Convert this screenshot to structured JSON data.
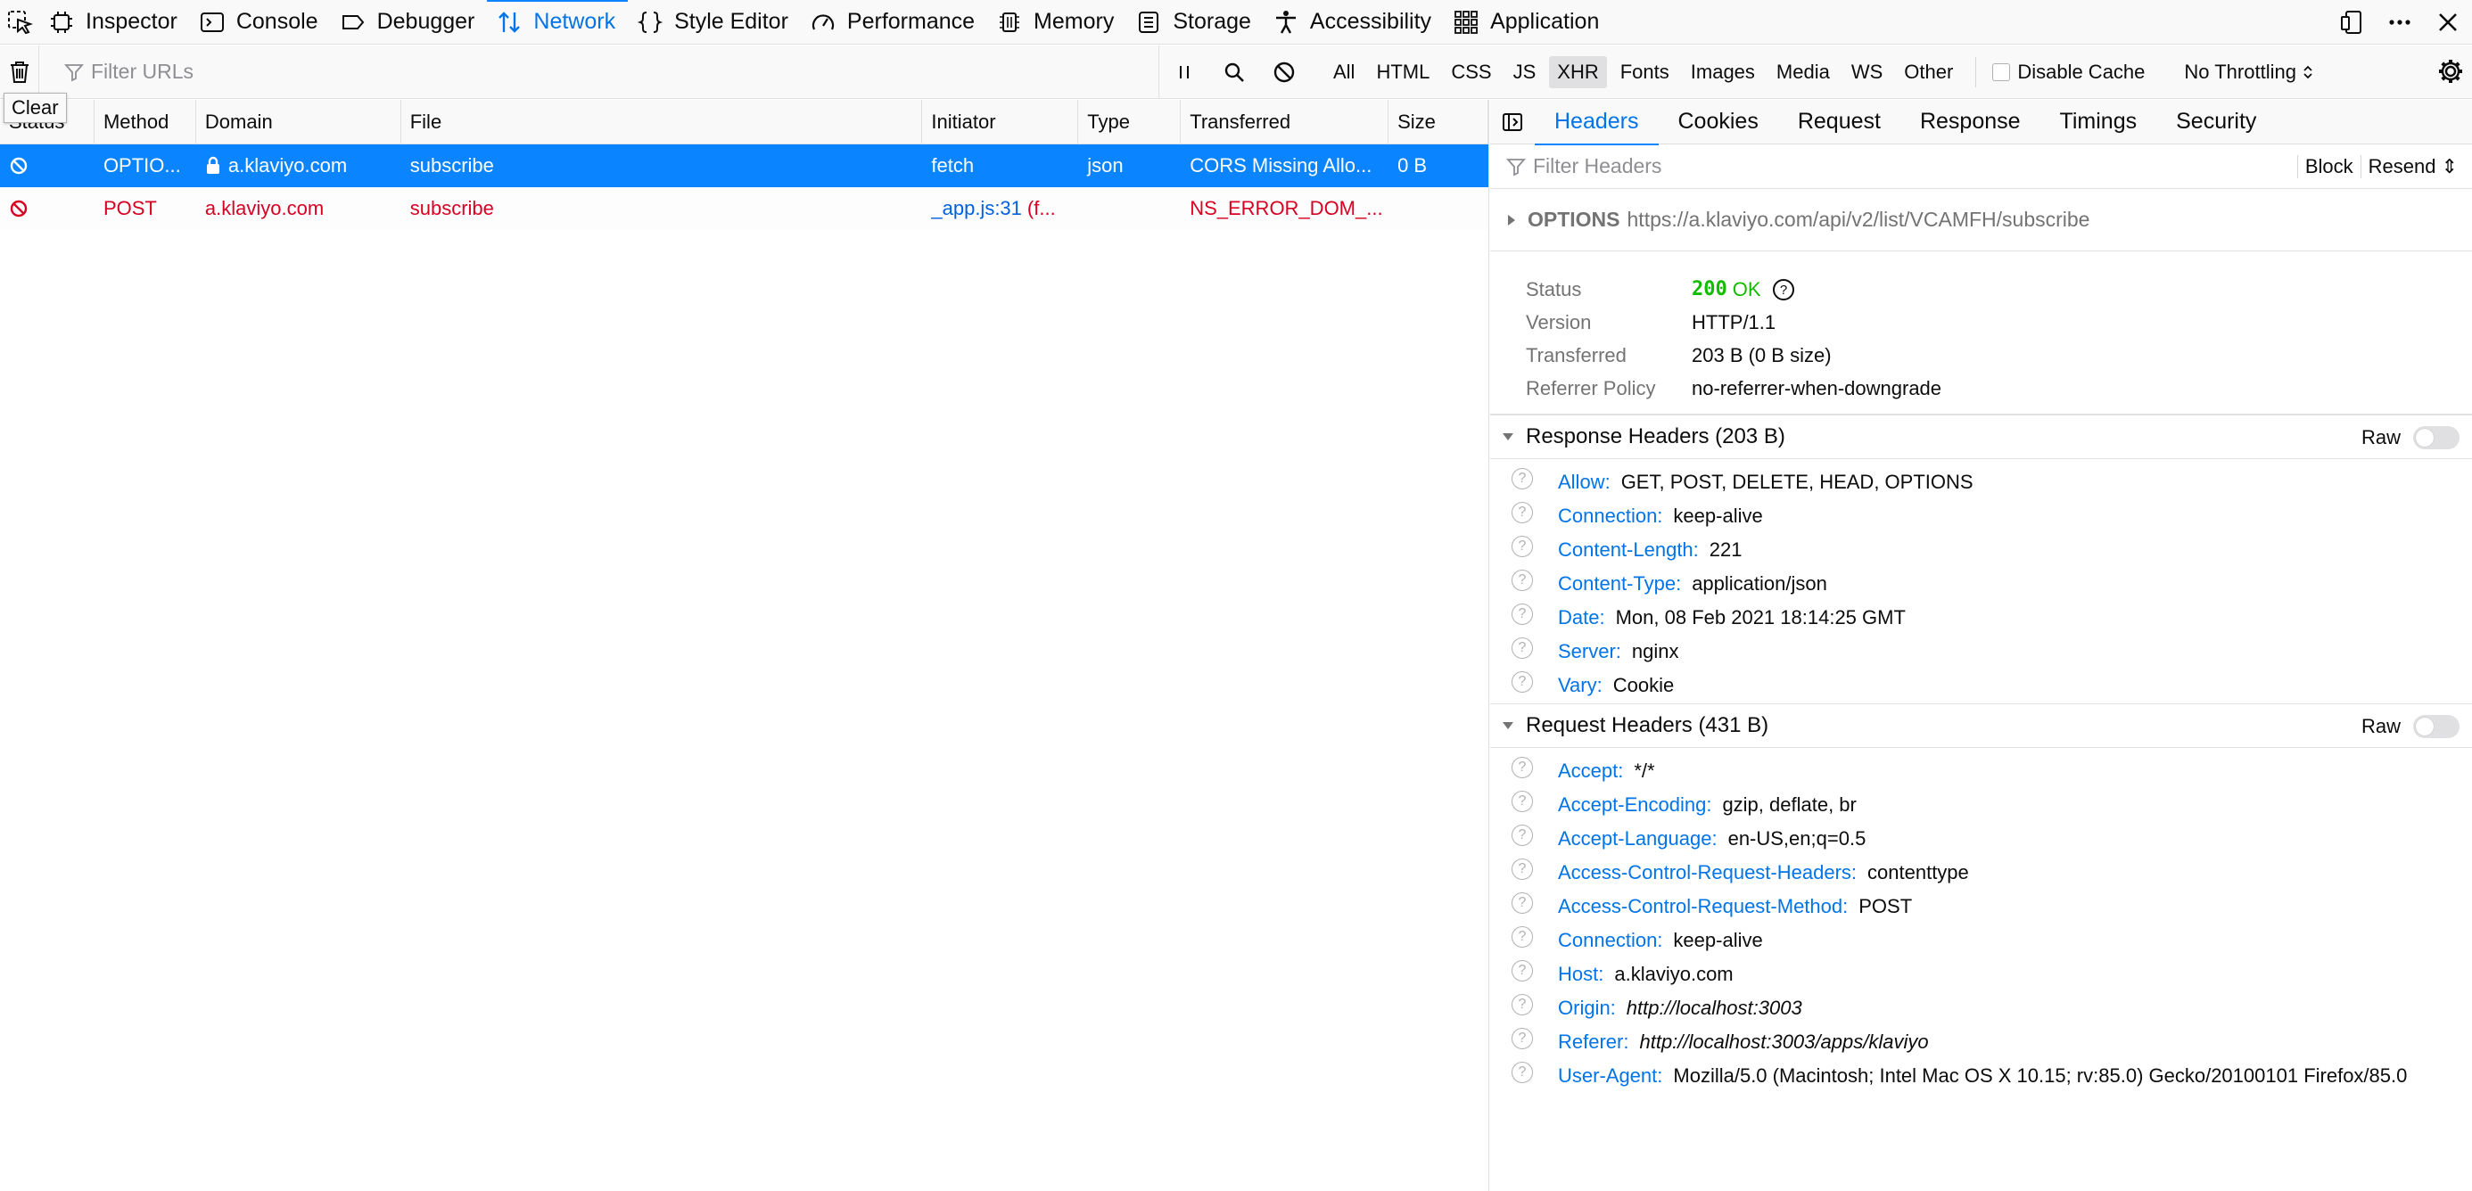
{
  "toolbar": {
    "tabs": [
      {
        "label": "Inspector",
        "icon": "inspector-icon"
      },
      {
        "label": "Console",
        "icon": "console-icon"
      },
      {
        "label": "Debugger",
        "icon": "debugger-icon"
      },
      {
        "label": "Network",
        "icon": "network-icon",
        "active": true
      },
      {
        "label": "Style Editor",
        "icon": "style-editor-icon"
      },
      {
        "label": "Performance",
        "icon": "performance-icon"
      },
      {
        "label": "Memory",
        "icon": "memory-icon"
      },
      {
        "label": "Storage",
        "icon": "storage-icon"
      },
      {
        "label": "Accessibility",
        "icon": "accessibility-icon"
      },
      {
        "label": "Application",
        "icon": "application-icon"
      }
    ]
  },
  "filterbar": {
    "filter_placeholder": "Filter URLs",
    "types": [
      "All",
      "HTML",
      "CSS",
      "JS",
      "XHR",
      "Fonts",
      "Images",
      "Media",
      "WS",
      "Other"
    ],
    "active_type": "XHR",
    "disable_cache": "Disable Cache",
    "throttling": "No Throttling"
  },
  "tooltip": "Clear",
  "list": {
    "columns": [
      "Status",
      "Method",
      "Domain",
      "File",
      "Initiator",
      "Type",
      "Transferred",
      "Size"
    ],
    "rows": [
      {
        "method": "OPTIO...",
        "domain": "a.klaviyo.com",
        "file": "subscribe",
        "initiator": "fetch",
        "type": "json",
        "transferred": "CORS Missing Allo...",
        "size": "0 B"
      },
      {
        "method": "POST",
        "domain": "a.klaviyo.com",
        "file": "subscribe",
        "initiator": "_app.js:31",
        "initiator_extra": "(f...",
        "type": "",
        "transferred": "NS_ERROR_DOM_...",
        "size": ""
      }
    ]
  },
  "side": {
    "tabs": [
      "Headers",
      "Cookies",
      "Request",
      "Response",
      "Timings",
      "Security"
    ],
    "filter_placeholder": "Filter Headers",
    "block": "Block",
    "resend": "Resend",
    "summary_method": "OPTIONS",
    "summary_url": "https://a.klaviyo.com/api/v2/list/VCAMFH/subscribe",
    "status": {
      "status_label": "Status",
      "status_code": "200",
      "status_text": "OK",
      "version_label": "Version",
      "version": "HTTP/1.1",
      "transferred_label": "Transferred",
      "transferred": "203 B (0 B size)",
      "referrer_label": "Referrer Policy",
      "referrer": "no-referrer-when-downgrade"
    },
    "response_title": "Response Headers (203 B)",
    "request_title": "Request Headers (431 B)",
    "raw": "Raw",
    "response_headers": [
      {
        "name": "Allow:",
        "value": "GET, POST, DELETE, HEAD, OPTIONS"
      },
      {
        "name": "Connection:",
        "value": "keep-alive"
      },
      {
        "name": "Content-Length:",
        "value": "221"
      },
      {
        "name": "Content-Type:",
        "value": "application/json"
      },
      {
        "name": "Date:",
        "value": "Mon, 08 Feb 2021 18:14:25 GMT"
      },
      {
        "name": "Server:",
        "value": "nginx"
      },
      {
        "name": "Vary:",
        "value": "Cookie"
      }
    ],
    "request_headers": [
      {
        "name": "Accept:",
        "value": "*/*"
      },
      {
        "name": "Accept-Encoding:",
        "value": "gzip, deflate, br"
      },
      {
        "name": "Accept-Language:",
        "value": "en-US,en;q=0.5"
      },
      {
        "name": "Access-Control-Request-Headers:",
        "value": "contenttype"
      },
      {
        "name": "Access-Control-Request-Method:",
        "value": "POST"
      },
      {
        "name": "Connection:",
        "value": "keep-alive"
      },
      {
        "name": "Host:",
        "value": "a.klaviyo.com"
      },
      {
        "name": "Origin:",
        "value": "http://localhost:3003",
        "italic": true
      },
      {
        "name": "Referer:",
        "value": "http://localhost:3003/apps/klaviyo",
        "italic": true
      },
      {
        "name": "User-Agent:",
        "value": "Mozilla/5.0 (Macintosh; Intel Mac OS X 10.15; rv:85.0) Gecko/20100101 Firefox/85.0"
      }
    ]
  }
}
